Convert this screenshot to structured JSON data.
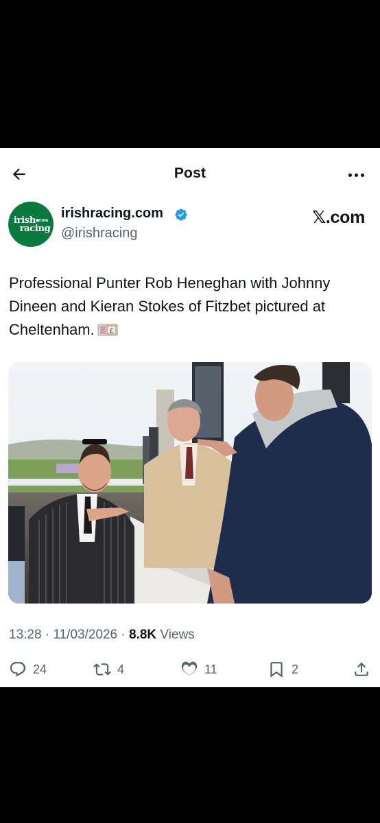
{
  "header": {
    "title": "Post",
    "back_icon": "arrow-left-icon",
    "more_icon": "more-horizontal-icon"
  },
  "author": {
    "display_name": "irishracing.com",
    "handle": "@irishracing",
    "avatar_line1": "irish",
    "avatar_dot": "●com",
    "avatar_line2": "racing",
    "verified": true,
    "avatar_color": "#0a7a3e",
    "verified_color": "#1d9bf0"
  },
  "watermark": {
    "x": "𝕏",
    "suffix": ".com"
  },
  "tweet": {
    "text": "Professional Punter Rob Heneghan with Johnny Dineen and Kieran Stokes of Fitzbet pictured at Cheltenham.",
    "emoji": "money-bag-emoji"
  },
  "meta": {
    "time": "13:28",
    "sep1": " · ",
    "date": "11/03/2026",
    "sep2": " · ",
    "views_count": "8.8K",
    "views_label": " Views"
  },
  "actions": {
    "replies": "24",
    "reposts": "4",
    "likes": "11",
    "bookmarks": "2"
  },
  "colors": {
    "text_primary": "#0f1419",
    "text_secondary": "#536471",
    "background": "#ffffff"
  }
}
